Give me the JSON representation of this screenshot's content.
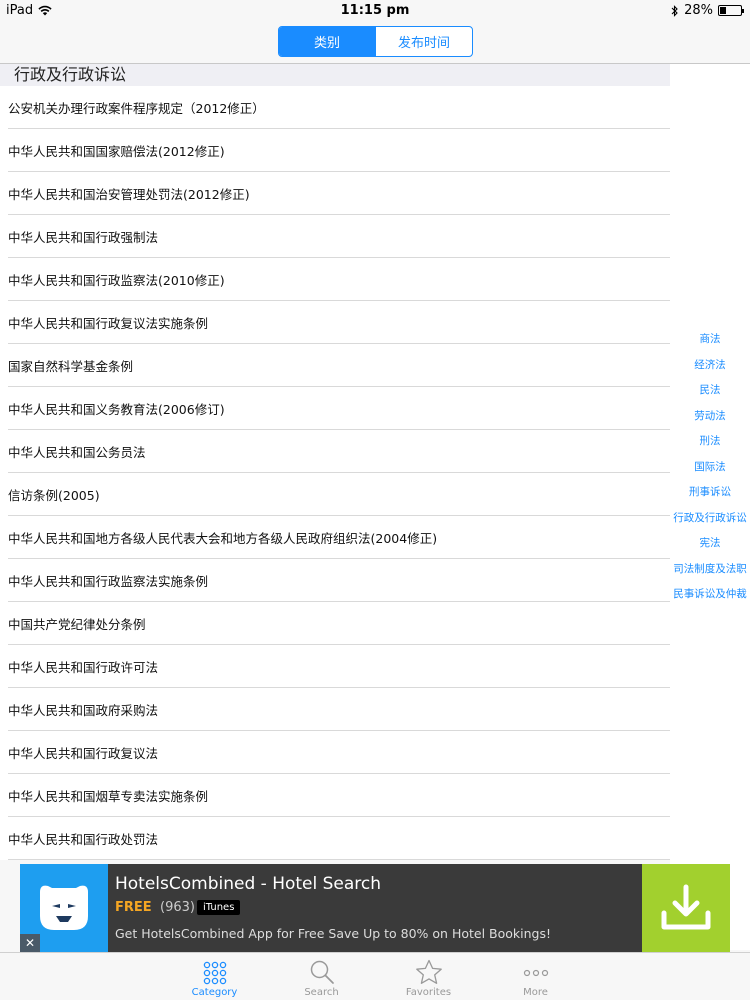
{
  "status_bar": {
    "device": "iPad",
    "time": "11:15 pm",
    "battery": "28%",
    "battery_level": 0.28
  },
  "navbar": {
    "segments": [
      {
        "label": "类别",
        "active": true
      },
      {
        "label": "发布时间",
        "active": false
      }
    ]
  },
  "section": {
    "title": "行政及行政诉讼"
  },
  "list_items": [
    "公安机关办理行政案件程序规定（2012修正）",
    "中华人民共和国国家赔偿法(2012修正)",
    "中华人民共和国治安管理处罚法(2012修正)",
    "中华人民共和国行政强制法",
    "中华人民共和国行政监察法(2010修正)",
    "中华人民共和国行政复议法实施条例",
    "国家自然科学基金条例",
    "中华人民共和国义务教育法(2006修订)",
    "中华人民共和国公务员法",
    "信访条例(2005)",
    "中华人民共和国地方各级人民代表大会和地方各级人民政府组织法(2004修正)",
    "中华人民共和国行政监察法实施条例",
    "中国共产党纪律处分条例",
    "中华人民共和国行政许可法",
    "中华人民共和国政府采购法",
    "中华人民共和国行政复议法",
    "中华人民共和国烟草专卖法实施条例",
    "中华人民共和国行政处罚法"
  ],
  "index_items": [
    "商法",
    "经济法",
    "民法",
    "劳动法",
    "刑法",
    "国际法",
    "刑事诉讼",
    "行政及行政诉讼",
    "宪法",
    "司法制度及法职",
    "民事诉讼及仲裁"
  ],
  "ad": {
    "title": "HotelsCombined - Hotel Search",
    "price": "FREE",
    "rating_count": "(963)",
    "store_badge": "iTunes",
    "description": "Get HotelsCombined App for Free Save Up to 80% on Hotel Bookings!",
    "close": "✕"
  },
  "tabbar": {
    "tabs": [
      {
        "label": "Category",
        "icon": "grid-icon"
      },
      {
        "label": "Search",
        "icon": "search-icon"
      },
      {
        "label": "Favorites",
        "icon": "star-icon"
      },
      {
        "label": "More",
        "icon": "more-icon"
      }
    ]
  },
  "colors": {
    "accent": "#1a8cff",
    "ad_download": "#a2d02e",
    "ad_price": "#f5a623"
  }
}
